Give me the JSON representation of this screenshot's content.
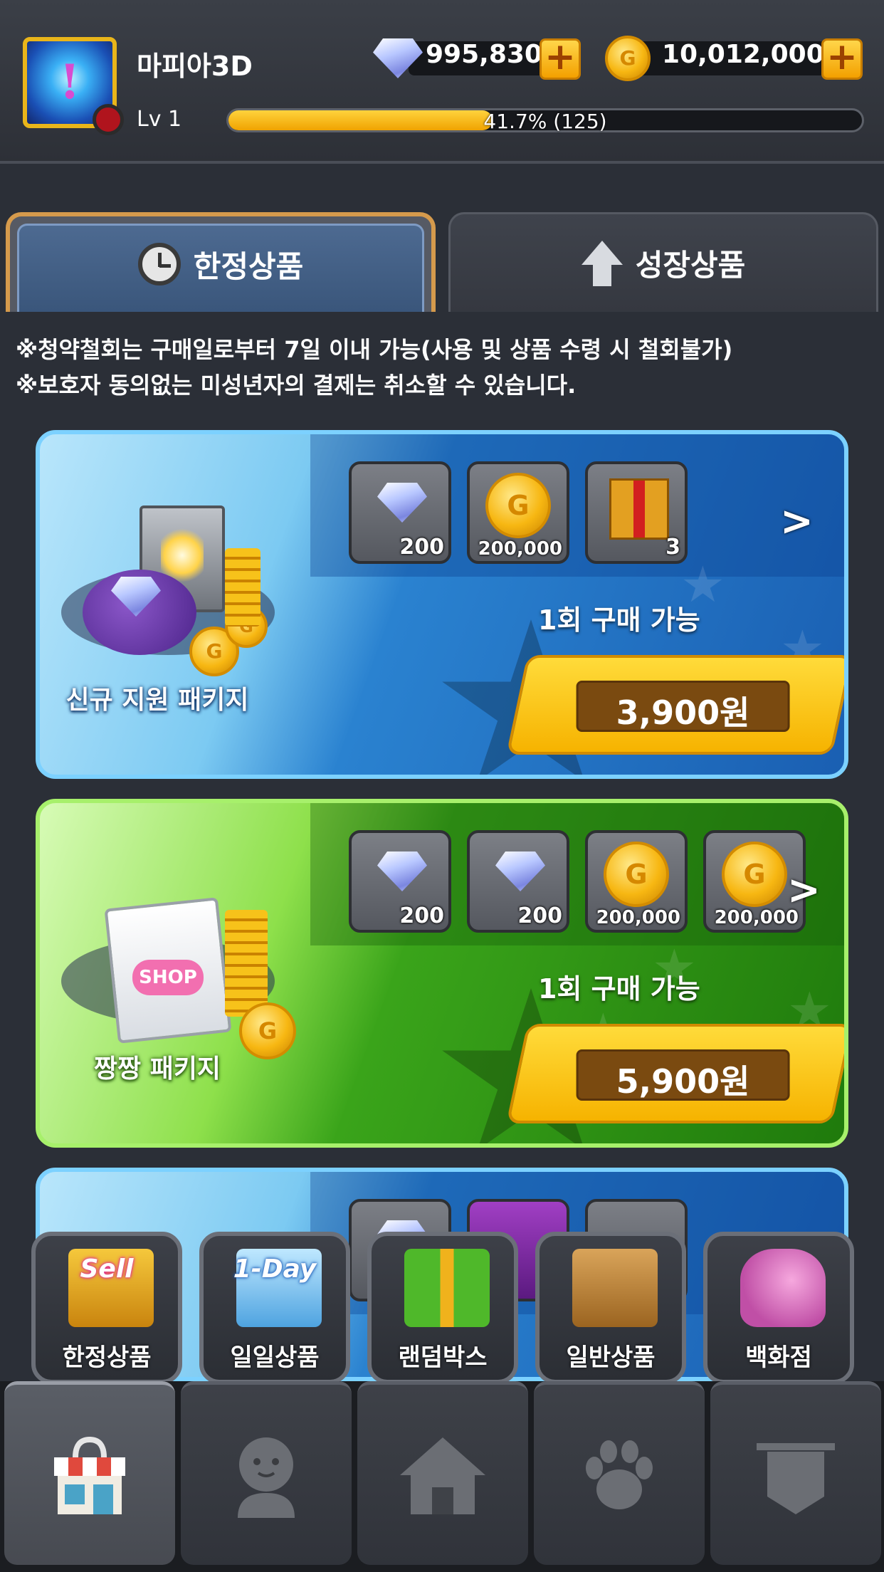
{
  "header": {
    "nickname": "마피아3D",
    "level": "Lv 1",
    "xp_text": "41.7% (125)",
    "xp_fraction": 0.417,
    "gems": "995,830",
    "gold": "10,012,000",
    "avatar_icon": "exclamation-icon"
  },
  "tabs": [
    {
      "label": "한정상품",
      "icon": "alarm-clock-icon",
      "selected": true
    },
    {
      "label": "성장상품",
      "icon": "up-arrow-icon",
      "selected": false
    }
  ],
  "notice": [
    "※청약철회는 구매일로부터 7일 이내 가능(사용 및 상품 수령 시 철회불가)",
    "※보호자 동의없는 미성년자의 결제는 취소할 수 있습니다."
  ],
  "packages": [
    {
      "name": "신규 지원 패키지",
      "items": [
        {
          "icon": "diamond-icon",
          "count": "200"
        },
        {
          "icon": "gold-coin-icon",
          "count": "200,000"
        },
        {
          "icon": "gift-box-icon",
          "count": "3"
        }
      ],
      "limit": "1회 구매 가능",
      "price": "3,900원",
      "theme_color": "#2a82d0"
    },
    {
      "name": "짱짱 패키지",
      "items": [
        {
          "icon": "diamond-icon",
          "count": "200"
        },
        {
          "icon": "diamond-icon",
          "count": "200"
        },
        {
          "icon": "gold-coin-icon",
          "count": "200,000"
        },
        {
          "icon": "gold-coin-icon",
          "count": "200,000"
        }
      ],
      "limit": "1회 구매 가능",
      "price": "5,900원",
      "theme_color": "#3aa41a"
    }
  ],
  "categories": [
    {
      "label": "한정상품",
      "badge": "Sell",
      "icon": "sale-box-icon"
    },
    {
      "label": "일일상품",
      "badge": "1-Day",
      "icon": "daily-box-icon"
    },
    {
      "label": "랜덤박스",
      "badge": "",
      "icon": "random-gift-icon"
    },
    {
      "label": "일반상품",
      "badge": "",
      "icon": "general-box-icon"
    },
    {
      "label": "백화점",
      "badge": "",
      "icon": "department-store-icon"
    }
  ],
  "bottom_nav": [
    {
      "name": "shop-icon",
      "selected": true
    },
    {
      "name": "character-icon",
      "selected": false
    },
    {
      "name": "home-icon",
      "selected": false
    },
    {
      "name": "pet-paw-icon",
      "selected": false
    },
    {
      "name": "guild-banner-icon",
      "selected": false
    }
  ]
}
